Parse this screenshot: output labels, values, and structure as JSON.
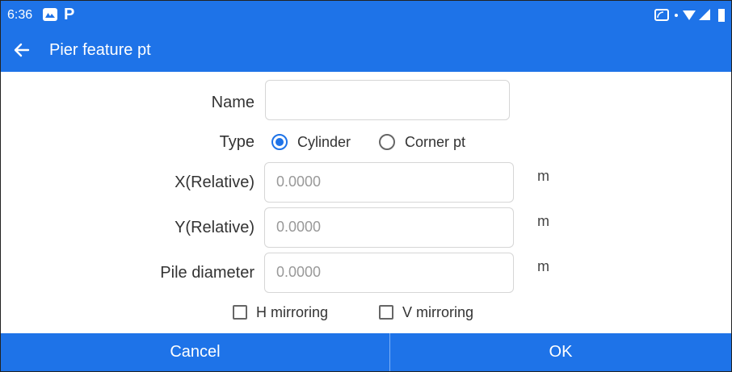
{
  "status": {
    "time": "6:36",
    "app_icon2": "P"
  },
  "app": {
    "title": "Pier feature pt"
  },
  "form": {
    "name_label": "Name",
    "name_value": "",
    "type_label": "Type",
    "type_options": [
      {
        "label": "Cylinder",
        "selected": true
      },
      {
        "label": "Corner pt",
        "selected": false
      }
    ],
    "x_label": "X(Relative)",
    "x_placeholder": "0.0000",
    "y_label": "Y(Relative)",
    "y_placeholder": "0.0000",
    "pile_label": "Pile diameter",
    "pile_placeholder": "0.0000",
    "unit": "m",
    "h_mirror_label": "H mirroring",
    "v_mirror_label": "V mirroring",
    "h_mirror_checked": false,
    "v_mirror_checked": false
  },
  "buttons": {
    "cancel": "Cancel",
    "ok": "OK"
  },
  "colors": {
    "primary": "#1e73e8",
    "background": "#ffffff"
  }
}
